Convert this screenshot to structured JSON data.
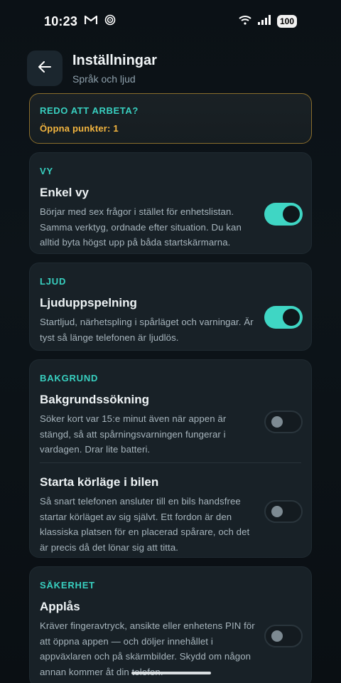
{
  "status": {
    "time": "10:23",
    "battery": "100"
  },
  "header": {
    "title": "Inställningar",
    "subtitle": "Språk och ljud"
  },
  "ready": {
    "title": "REDO ATT ARBETA?",
    "subtitle": "Öppna punkter: 1"
  },
  "sections": [
    {
      "label": "VY",
      "rows": [
        {
          "title": "Enkel vy",
          "desc": "Börjar med sex frågor i stället för enhetslistan. Samma verktyg, ordnade efter situation. Du kan alltid byta högst upp på båda startskärmarna.",
          "on": true
        }
      ]
    },
    {
      "label": "LJUD",
      "rows": [
        {
          "title": "Ljuduppspelning",
          "desc": "Startljud, närhetspling i spårläget och varningar. Är tyst så länge telefonen är ljudlös.",
          "on": true
        }
      ]
    },
    {
      "label": "BAKGRUND",
      "rows": [
        {
          "title": "Bakgrundssökning",
          "desc": "Söker kort var 15:e minut även när appen är stängd, så att spårningsvarningen fungerar i vardagen. Drar lite batteri.",
          "on": false
        },
        {
          "title": "Starta körläge i bilen",
          "desc": "Så snart telefonen ansluter till en bils handsfree startar körläget av sig självt. Ett fordon är den klassiska platsen för en placerad spårare, och det är precis då det lönar sig att titta.",
          "on": false
        }
      ]
    },
    {
      "label": "SÄKERHET",
      "rows": [
        {
          "title": "Applås",
          "desc": "Kräver fingeravtryck, ansikte eller enhetens PIN för att öppna appen — och döljer innehållet i appväxlaren och på skärmbilder. Skydd om någon annan kommer åt din telefon.",
          "on": false
        }
      ]
    }
  ]
}
